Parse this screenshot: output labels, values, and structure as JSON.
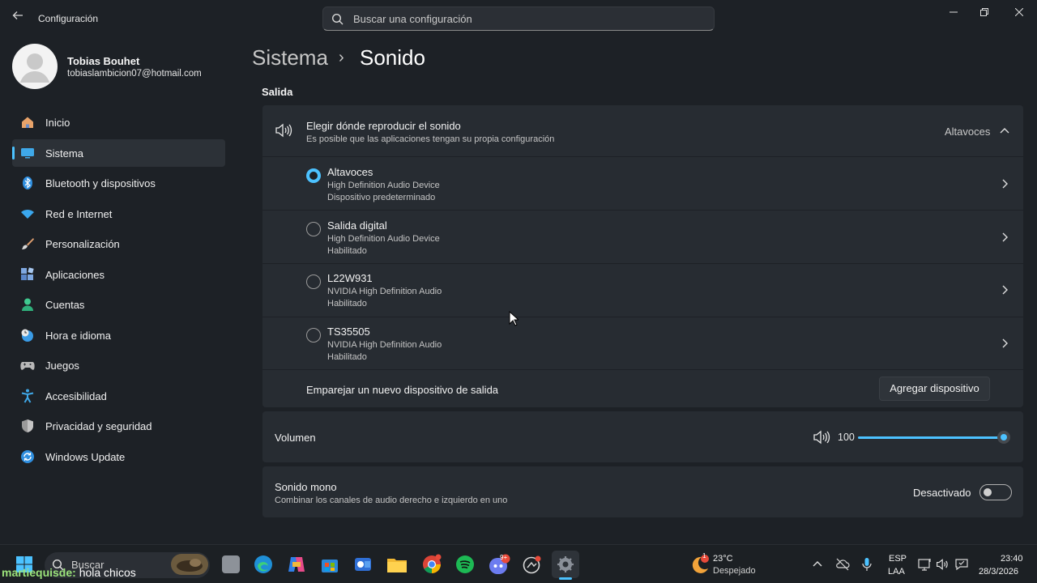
{
  "window": {
    "title": "Configuración",
    "search_placeholder": "Buscar una configuración",
    "controls": [
      "—",
      "▢",
      "✕"
    ]
  },
  "profile": {
    "name": "Tobias Bouhet",
    "email": "tobiaslambicion07@hotmail.com"
  },
  "sidebar": {
    "active_index": 1,
    "items": [
      {
        "label": "Inicio",
        "icon": "home-icon"
      },
      {
        "label": "Sistema",
        "icon": "system-icon"
      },
      {
        "label": "Bluetooth y dispositivos",
        "icon": "bluetooth-icon"
      },
      {
        "label": "Red e Internet",
        "icon": "wifi-icon"
      },
      {
        "label": "Personalización",
        "icon": "brush-icon"
      },
      {
        "label": "Aplicaciones",
        "icon": "apps-icon"
      },
      {
        "label": "Cuentas",
        "icon": "person-icon"
      },
      {
        "label": "Hora e idioma",
        "icon": "clock-globe-icon"
      },
      {
        "label": "Juegos",
        "icon": "gamepad-icon"
      },
      {
        "label": "Accesibilidad",
        "icon": "accessibility-icon"
      },
      {
        "label": "Privacidad y seguridad",
        "icon": "shield-icon"
      },
      {
        "label": "Windows Update",
        "icon": "update-icon"
      }
    ]
  },
  "breadcrumb": {
    "parent": "Sistema",
    "separator": "›",
    "current": "Sonido"
  },
  "output": {
    "section_title": "Salida",
    "choose": {
      "title": "Elegir dónde reproducir el sonido",
      "subtitle": "Es posible que las aplicaciones tengan su propia configuración",
      "value": "Altavoces"
    },
    "devices": [
      {
        "name": "Altavoces",
        "line1": "High Definition Audio Device",
        "line2": "Dispositivo predeterminado",
        "selected": true
      },
      {
        "name": "Salida digital",
        "line1": "High Definition Audio Device",
        "line2": "Habilitado",
        "selected": false
      },
      {
        "name": "L22W931",
        "line1": "NVIDIA High Definition Audio",
        "line2": "Habilitado",
        "selected": false
      },
      {
        "name": "TS35505",
        "line1": "NVIDIA High Definition Audio",
        "line2": "Habilitado",
        "selected": false
      }
    ],
    "pair": {
      "label": "Emparejar un nuevo dispositivo de salida",
      "button": "Agregar dispositivo"
    }
  },
  "volume": {
    "label": "Volumen",
    "value": "100",
    "level_percent": 100
  },
  "mono": {
    "title": "Sonido mono",
    "subtitle": "Combinar los canales de audio derecho e izquierdo en uno",
    "state": "Desactivado",
    "on": false
  },
  "taskbar": {
    "search_label": "Buscar",
    "weather_temp": "23°C",
    "weather_desc": "Despejado",
    "weather_badge": "1",
    "lang_top": "ESP",
    "lang_bottom": "LAA",
    "time": "23:40",
    "date": "28/3/2026",
    "discord_badge": "9+"
  },
  "chat_overlay": {
    "user": "martiequisde:",
    "message": " hola chicos"
  },
  "colors": {
    "accent": "#4cc2ff",
    "background": "#1d2126",
    "card": "#272c32"
  }
}
